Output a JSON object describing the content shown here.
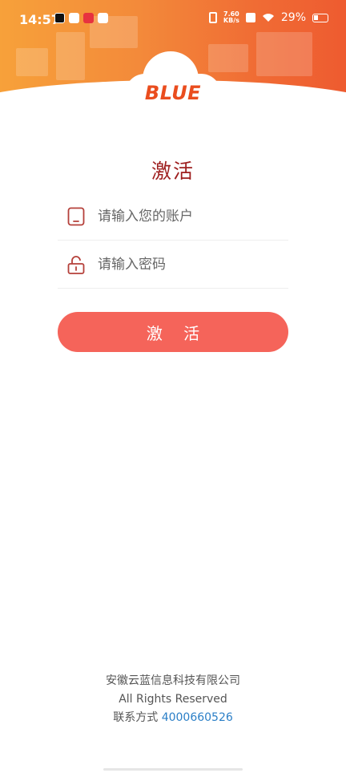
{
  "status_bar": {
    "time": "14:57",
    "net_speed_value": "7.60",
    "net_speed_unit": "KB/s",
    "battery": "29%"
  },
  "logo": {
    "text": "BLUE"
  },
  "page": {
    "title": "激活",
    "account_placeholder": "请输入您的账户",
    "password_placeholder": "请输入密码",
    "submit_label": "激 活"
  },
  "footer": {
    "company": "安徽云蓝信息科技有限公司",
    "rights": "All Rights Reserved",
    "contact_label": "联系方式 ",
    "contact_phone": "4000660526"
  },
  "colors": {
    "banner_start": "#f7a13a",
    "banner_end": "#ee5b30",
    "title": "#9e1f1f",
    "button": "#f5645a",
    "logo": "#ea4d1e",
    "link": "#2b7fc7"
  }
}
